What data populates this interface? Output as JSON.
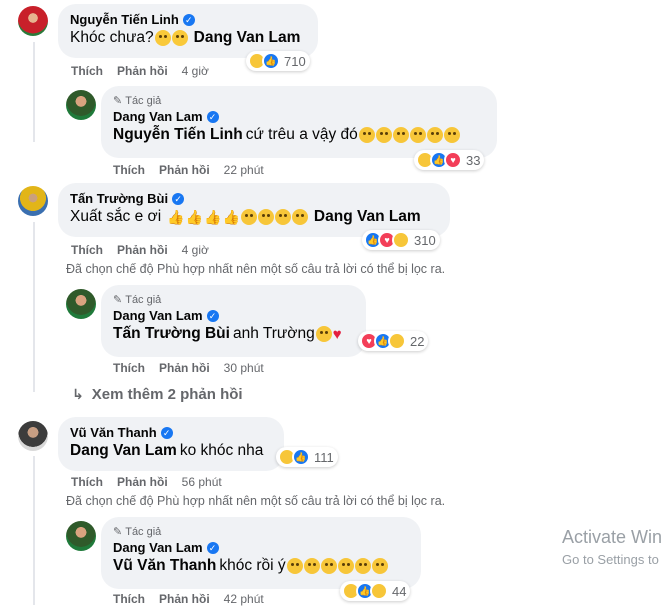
{
  "actions": {
    "like": "Thích",
    "reply": "Phản hồi"
  },
  "author_badge": "Tác giả",
  "comments": [
    {
      "name": "Nguyễn Tiến Linh",
      "text": "Khóc chưa?",
      "mention": "Dang Van Lam",
      "time": "4 giờ",
      "reaction_count": "710"
    },
    {
      "name": "Dang Van Lam",
      "mention": "Nguyễn Tiến Linh",
      "text": "cứ trêu a vậy đó",
      "time": "22 phút",
      "reaction_count": "33"
    },
    {
      "name": "Tấn Trường Bùi",
      "text": "Xuất sắc e ơi",
      "mention": "Dang Van Lam",
      "time": "4 giờ",
      "reaction_count": "310"
    },
    {
      "name": "Dang Van Lam",
      "mention": "Tấn Trường Bùi",
      "text": "anh Trường",
      "time": "30 phút",
      "reaction_count": "22"
    },
    {
      "name": "Vũ Văn Thanh",
      "mention": "Dang Van Lam",
      "text": "ko khóc nha",
      "time": "56 phút",
      "reaction_count": "111"
    },
    {
      "name": "Dang Van Lam",
      "mention": "Vũ Văn Thanh",
      "text": "khóc rồi ý",
      "time": "42 phút",
      "reaction_count": "44"
    }
  ],
  "filtered_notice": "Đã chọn chế độ Phù hợp nhất nên một số câu trả lời có thể bị lọc ra.",
  "more_replies": "Xem thêm 2 phản hồi",
  "watermark": {
    "line1": "Activate Win",
    "line2": "Go to Settings to"
  },
  "colors": {
    "bubble": "#f0f2f5",
    "verified": "#1877f2",
    "secondary_text": "#65676b"
  }
}
